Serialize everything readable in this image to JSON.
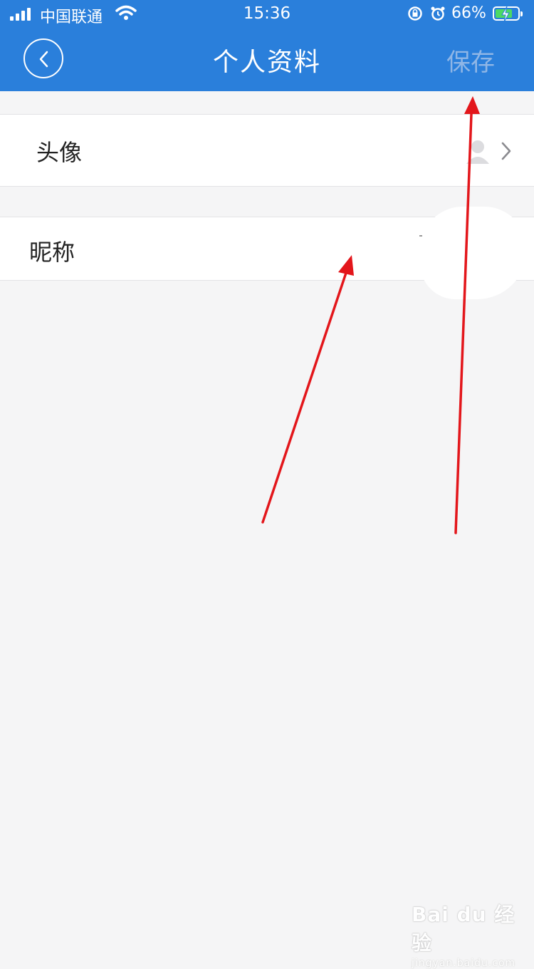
{
  "status_bar": {
    "carrier": "中国联通",
    "time": "15:36",
    "battery_percent": "66%"
  },
  "nav": {
    "title": "个人资料",
    "save_label": "保存",
    "back_icon": "chevron-left-icon"
  },
  "rows": [
    {
      "label": "头像",
      "icons": [
        "avatar-placeholder-icon",
        "chevron-right-icon"
      ]
    },
    {
      "label": "昵称"
    }
  ],
  "colors": {
    "nav_bar": "#2a7fdb",
    "save_disabled": "#8fb6e6",
    "background": "#f5f5f6",
    "annotation_arrow": "#e3161b"
  },
  "watermark": {
    "brand": "Bai du 经验",
    "url": "jingyan.baidu.com"
  }
}
